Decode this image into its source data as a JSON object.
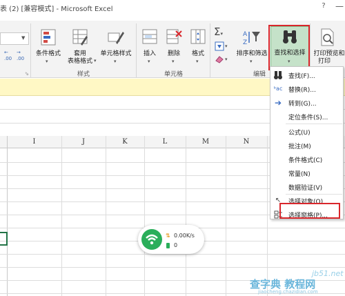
{
  "title_bar": {
    "title": "表 (2) [兼容模式] - Microsoft Excel",
    "help": "?"
  },
  "ribbon": {
    "groups": {
      "styles": {
        "label": "样式",
        "buttons": {
          "conditional_format": "条件格式",
          "table_format": [
            "套用",
            "表格格式"
          ],
          "cell_styles": "单元格样式"
        }
      },
      "cells": {
        "label": "单元格",
        "buttons": {
          "insert": "插入",
          "delete": "删除",
          "format": "格式"
        }
      },
      "editing": {
        "label": "编辑",
        "buttons": {
          "sort_filter": "排序和筛选",
          "find_select": "查找和选择",
          "print_preview": [
            "打印预览和",
            "打印"
          ]
        }
      }
    },
    "number": {
      "inc_decimal": ".00",
      "dec_decimal": ".00"
    }
  },
  "columns": [
    "I",
    "J",
    "K",
    "L",
    "M",
    "N"
  ],
  "menu": {
    "items": [
      {
        "label": "查找(F)...",
        "icon": "binoculars-icon"
      },
      {
        "label": "替换(R)...",
        "icon": "replace-icon"
      },
      {
        "label": "转到(G)...",
        "icon": "arrow-right-icon"
      },
      {
        "label": "定位条件(S)..."
      },
      {
        "label": "公式(U)"
      },
      {
        "label": "批注(M)"
      },
      {
        "label": "条件格式(C)"
      },
      {
        "label": "常量(N)"
      },
      {
        "label": "数据验证(V)"
      },
      {
        "label": "选择对象(O)",
        "icon": "pointer-icon"
      },
      {
        "label": "选择窗格(P)...",
        "icon": "selection-pane-icon"
      }
    ]
  },
  "net_widget": {
    "speed": "0.00K/s",
    "battery": "0",
    "upload_icon": "up-down-arrows-icon",
    "battery_icon": "battery-icon"
  },
  "watermark": {
    "line1": "jb51.net",
    "line2": "查字典 教程网",
    "line3": "jiaocheng.chazidian.com"
  },
  "colors": {
    "highlight": "#d9262b",
    "accent_green": "#2aae5a",
    "selected_btn": "#c5e2c9"
  }
}
